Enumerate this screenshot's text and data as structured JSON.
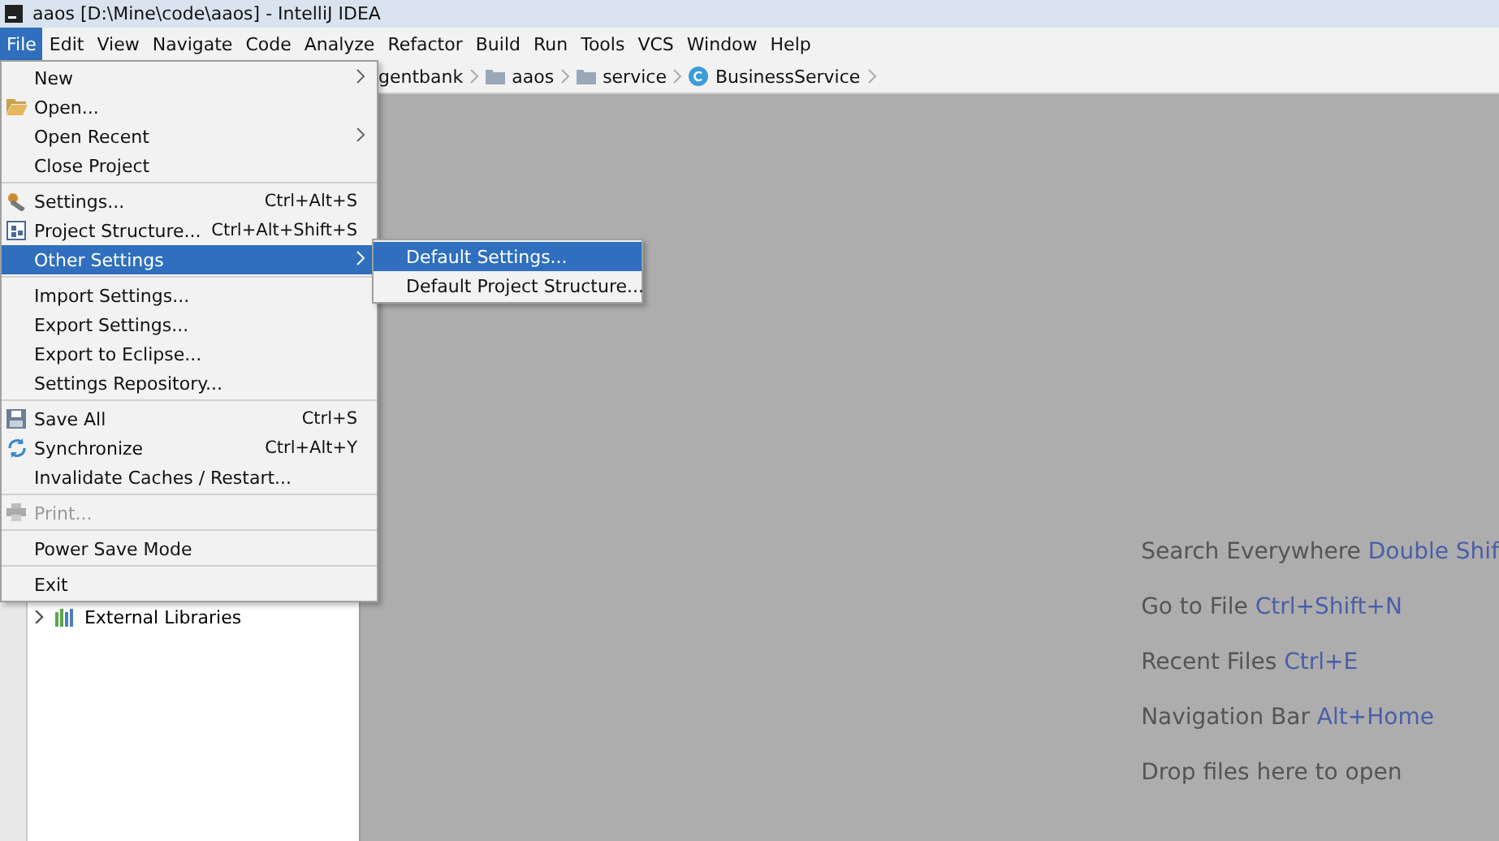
{
  "window": {
    "title": "aaos [D:\\Mine\\code\\aaos] - IntelliJ IDEA"
  },
  "menubar": [
    {
      "label": "File",
      "selected": true
    },
    {
      "label": "Edit",
      "selected": false
    },
    {
      "label": "View",
      "selected": false
    },
    {
      "label": "Navigate",
      "selected": false
    },
    {
      "label": "Code",
      "selected": false
    },
    {
      "label": "Analyze",
      "selected": false
    },
    {
      "label": "Refactor",
      "selected": false
    },
    {
      "label": "Build",
      "selected": false
    },
    {
      "label": "Run",
      "selected": false
    },
    {
      "label": "Tools",
      "selected": false
    },
    {
      "label": "VCS",
      "selected": false
    },
    {
      "label": "Window",
      "selected": false
    },
    {
      "label": "Help",
      "selected": false
    }
  ],
  "breadcrumbs": [
    {
      "kind": "text",
      "label": "gentbank"
    },
    {
      "kind": "folder",
      "label": "aaos"
    },
    {
      "kind": "folder",
      "label": "service"
    },
    {
      "kind": "class",
      "label": "BusinessService"
    }
  ],
  "project_tree": [
    {
      "label": "External Libraries",
      "expanded": false
    }
  ],
  "file_menu": [
    {
      "kind": "item",
      "label": "New",
      "submenu": true,
      "selected": false,
      "disabled": false
    },
    {
      "kind": "item",
      "label": "Open...",
      "selected": false,
      "disabled": false
    },
    {
      "kind": "item",
      "label": "Open Recent",
      "submenu": true,
      "selected": false,
      "disabled": false
    },
    {
      "kind": "item",
      "label": "Close Project",
      "selected": false,
      "disabled": false
    },
    {
      "kind": "separator"
    },
    {
      "kind": "item",
      "label": "Settings...",
      "shortcut": "Ctrl+Alt+S",
      "selected": false,
      "disabled": false
    },
    {
      "kind": "item",
      "label": "Project Structure...",
      "shortcut": "Ctrl+Alt+Shift+S",
      "selected": false,
      "disabled": false
    },
    {
      "kind": "item",
      "label": "Other Settings",
      "submenu": true,
      "selected": true,
      "disabled": false
    },
    {
      "kind": "separator"
    },
    {
      "kind": "item",
      "label": "Import Settings...",
      "selected": false,
      "disabled": false
    },
    {
      "kind": "item",
      "label": "Export Settings...",
      "selected": false,
      "disabled": false
    },
    {
      "kind": "item",
      "label": "Export to Eclipse...",
      "selected": false,
      "disabled": false
    },
    {
      "kind": "item",
      "label": "Settings Repository...",
      "selected": false,
      "disabled": false
    },
    {
      "kind": "separator"
    },
    {
      "kind": "item",
      "label": "Save All",
      "shortcut": "Ctrl+S",
      "selected": false,
      "disabled": false
    },
    {
      "kind": "item",
      "label": "Synchronize",
      "shortcut": "Ctrl+Alt+Y",
      "selected": false,
      "disabled": false
    },
    {
      "kind": "item",
      "label": "Invalidate Caches / Restart...",
      "selected": false,
      "disabled": false
    },
    {
      "kind": "separator"
    },
    {
      "kind": "item",
      "label": "Print...",
      "selected": false,
      "disabled": true
    },
    {
      "kind": "separator"
    },
    {
      "kind": "item",
      "label": "Power Save Mode",
      "selected": false,
      "disabled": false
    },
    {
      "kind": "separator"
    },
    {
      "kind": "item",
      "label": "Exit",
      "selected": false,
      "disabled": false
    }
  ],
  "submenu": [
    {
      "label": "Default Settings...",
      "selected": true
    },
    {
      "label": "Default Project Structure...",
      "selected": false
    }
  ],
  "hints": [
    {
      "label": "Search Everywhere",
      "shortcut": "Double Shif"
    },
    {
      "label": "Go to File",
      "shortcut": "Ctrl+Shift+N"
    },
    {
      "label": "Recent Files",
      "shortcut": "Ctrl+E"
    },
    {
      "label": "Navigation Bar",
      "shortcut": "Alt+Home"
    },
    {
      "label": "Drop files here to open"
    }
  ]
}
